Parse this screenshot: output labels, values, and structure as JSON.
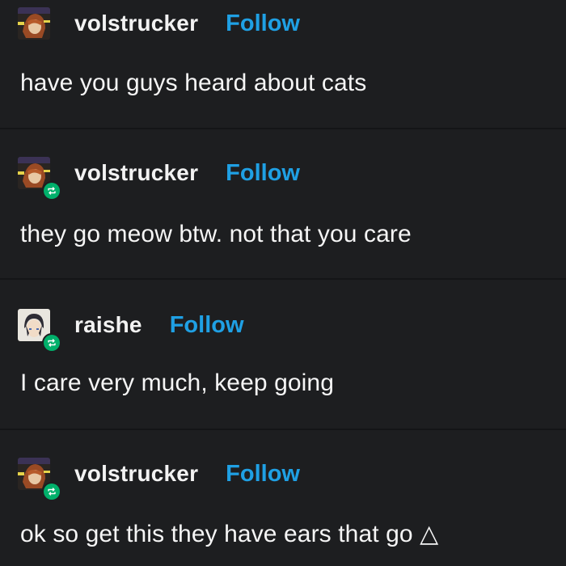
{
  "posts": [
    {
      "username": "volstrucker",
      "follow_label": "Follow",
      "text": "have you guys heard about cats",
      "reblogged": false,
      "avatar": "anime-avatar-redhead"
    },
    {
      "username": "volstrucker",
      "follow_label": "Follow",
      "text": "they go meow btw. not that you care",
      "reblogged": true,
      "avatar": "anime-avatar-redhead"
    },
    {
      "username": "raishe",
      "follow_label": "Follow",
      "text": "I care very much, keep going",
      "reblogged": true,
      "avatar": "anime-avatar-darkhair"
    },
    {
      "username": "volstrucker",
      "follow_label": "Follow",
      "text": "ok so get this they have ears that go △",
      "reblogged": true,
      "avatar": "anime-avatar-redhead"
    }
  ],
  "colors": {
    "background": "#1d1e20",
    "text": "#f5f5f5",
    "follow": "#1fa0e4",
    "reblog_badge": "#00b06b"
  },
  "icons": {
    "reblog": "reblog-icon"
  }
}
